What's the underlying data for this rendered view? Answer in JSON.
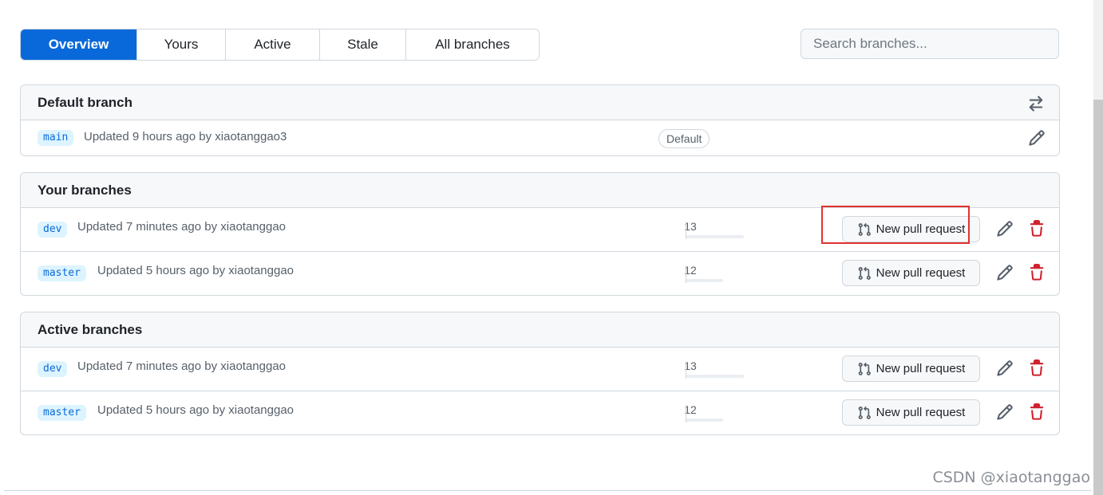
{
  "tabs": [
    "Overview",
    "Yours",
    "Active",
    "Stale",
    "All branches"
  ],
  "search": {
    "placeholder": "Search branches..."
  },
  "default_section": {
    "title": "Default branch",
    "branch": {
      "name": "main",
      "updated": "Updated 9 hours ago by xiaotanggao3",
      "label": "Default"
    }
  },
  "your_section": {
    "title": "Your branches",
    "rows": [
      {
        "name": "dev",
        "updated": "Updated 7 minutes ago by xiaotanggao",
        "behind": "1",
        "ahead": "3",
        "button": "New pull request"
      },
      {
        "name": "master",
        "updated": "Updated 5 hours ago by xiaotanggao",
        "behind": "1",
        "ahead": "2",
        "button": "New pull request"
      }
    ]
  },
  "active_section": {
    "title": "Active branches",
    "rows": [
      {
        "name": "dev",
        "updated": "Updated 7 minutes ago by xiaotanggao",
        "behind": "1",
        "ahead": "3",
        "button": "New pull request"
      },
      {
        "name": "master",
        "updated": "Updated 5 hours ago by xiaotanggao",
        "behind": "1",
        "ahead": "2",
        "button": "New pull request"
      }
    ]
  },
  "watermark": "CSDN @xiaotanggao",
  "colors": {
    "accent": "#0969da",
    "danger": "#cf222e",
    "highlight": "#e0322e"
  },
  "icons": {
    "switch": "arrow-switch-icon",
    "edit": "pencil-icon",
    "delete": "trash-icon",
    "pr": "git-pull-request-icon"
  }
}
